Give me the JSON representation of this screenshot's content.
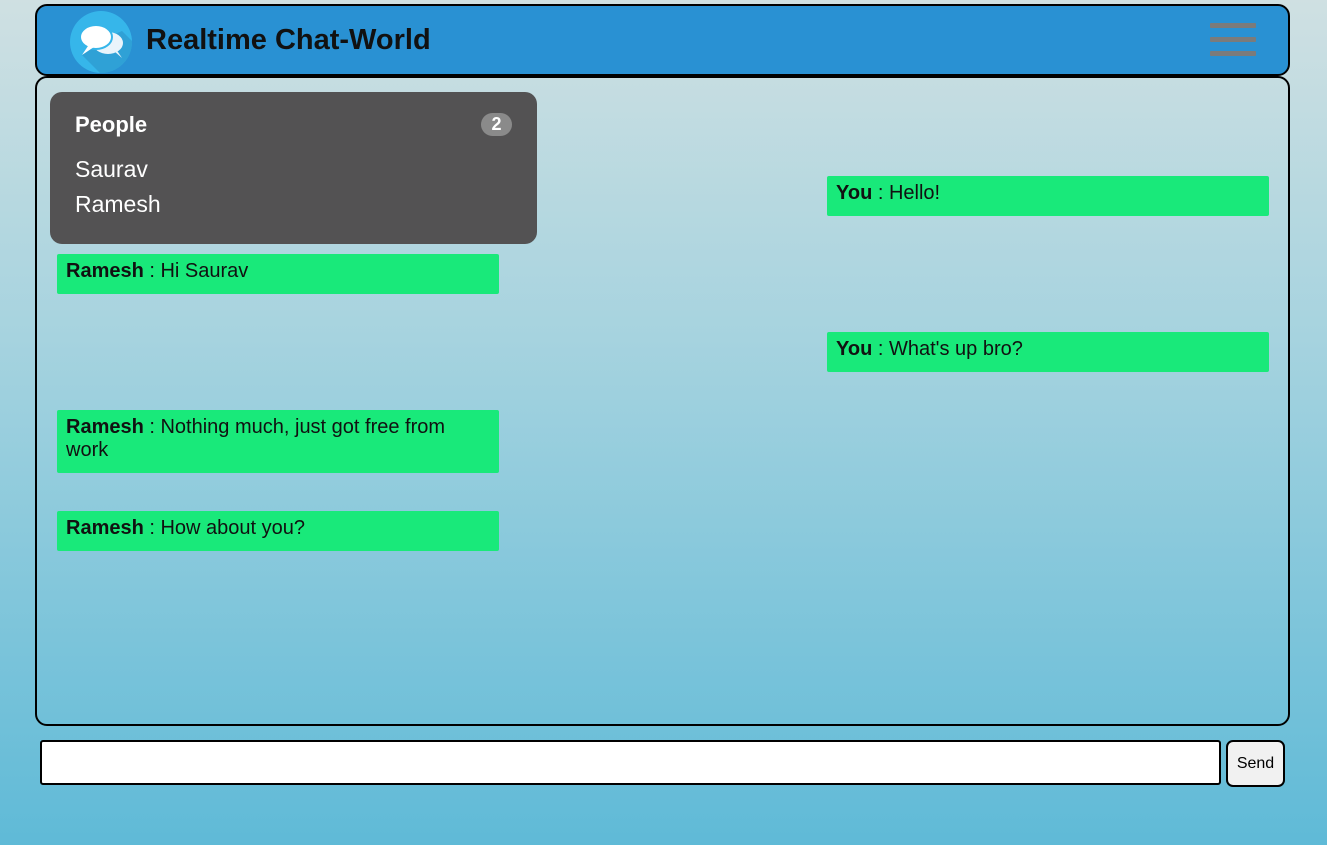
{
  "header": {
    "title": "Realtime Chat-World",
    "brand_color": "#2991d3",
    "logo_icon": "chat-bubbles-icon",
    "menu_icon": "hamburger-menu-icon"
  },
  "people": {
    "title": "People",
    "count": "2",
    "list": [
      "Saurav",
      "Ramesh"
    ]
  },
  "messages": [
    {
      "sender": "You",
      "text": " : Hello!",
      "side": "right"
    },
    {
      "sender": "Ramesh",
      "text": " : Hi Saurav",
      "side": "left"
    },
    {
      "sender": "You",
      "text": " : What's up bro?",
      "side": "right"
    },
    {
      "sender": "Ramesh",
      "text": " : Nothing much, just got free from work",
      "side": "left"
    },
    {
      "sender": "Ramesh",
      "text": " : How about you?",
      "side": "left"
    }
  ],
  "composer": {
    "value": "",
    "send_label": "Send"
  },
  "colors": {
    "message_bubble": "#19e97a",
    "people_panel": "#535253"
  }
}
